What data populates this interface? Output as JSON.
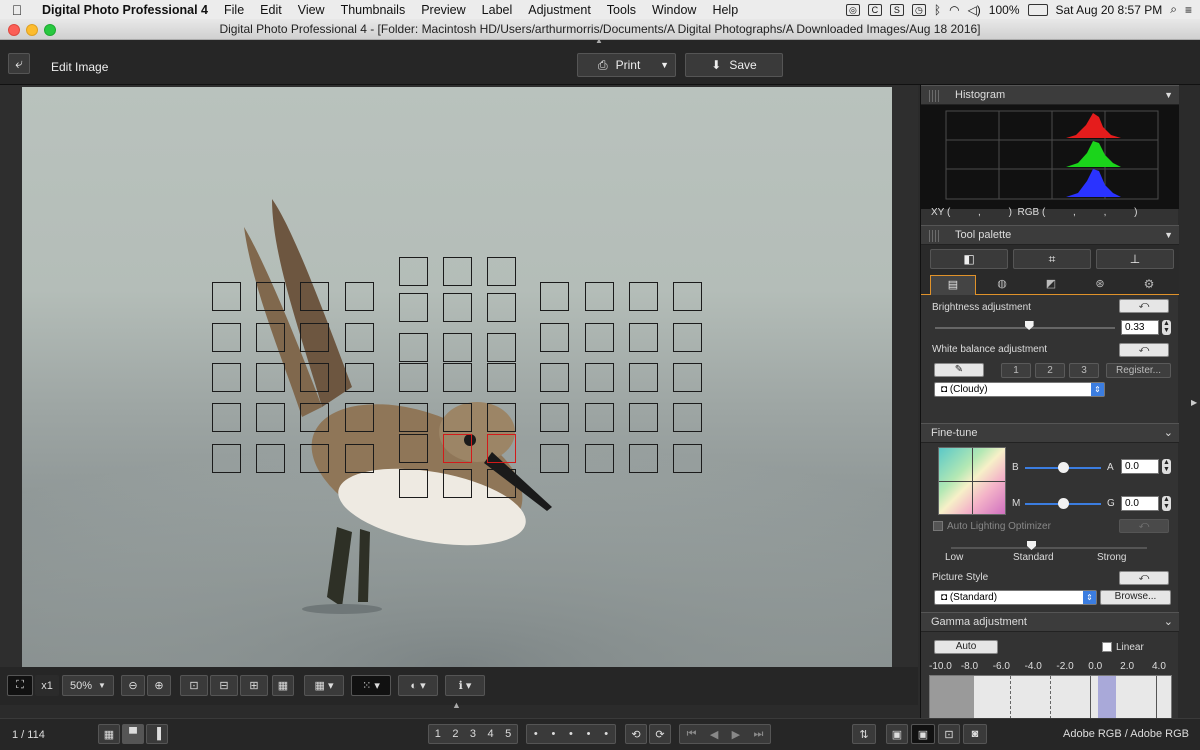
{
  "menubar": {
    "app_name": "Digital Photo Professional 4",
    "items": [
      "File",
      "Edit",
      "View",
      "Thumbnails",
      "Preview",
      "Label",
      "Adjustment",
      "Tools",
      "Window",
      "Help"
    ],
    "battery": "100%",
    "datetime": "Sat Aug 20  8:57 PM"
  },
  "window": {
    "title": "Digital Photo Professional 4 - [Folder: Macintosh HD/Users/arthurmorris/Documents/A Digital Photographs/A Downloaded Images/Aug 18 2016]"
  },
  "toolbar": {
    "mode_label": "Edit Image",
    "print_label": "Print",
    "save_label": "Save"
  },
  "histogram": {
    "title": "Histogram",
    "xy_readout": "XY (          ,          )  RGB (          ,          ,          )"
  },
  "tool_palette": {
    "title": "Tool palette",
    "brightness": {
      "label": "Brightness adjustment",
      "value": "0.33",
      "level": 0.52
    },
    "white_balance": {
      "label": "White balance adjustment",
      "presets": [
        "1",
        "2",
        "3"
      ],
      "register_label": "Register...",
      "selected": "(Cloudy)"
    },
    "fine_tune": {
      "label": "Fine-tune",
      "b_label": "B",
      "a_label": "A",
      "a_value": "0.0",
      "m_label": "M",
      "g_label": "G",
      "g_value": "0.0"
    },
    "alo": {
      "label": "Auto Lighting Optimizer",
      "levels": [
        "Low",
        "Standard",
        "Strong"
      ]
    },
    "picture_style": {
      "label": "Picture Style",
      "selected": "(Standard)",
      "browse_label": "Browse..."
    },
    "gamma": {
      "label": "Gamma adjustment",
      "auto_label": "Auto",
      "linear_label": "Linear",
      "ticks": [
        "-10.0",
        "-8.0",
        "-6.0",
        "-4.0",
        "-2.0",
        "0.0",
        "2.0",
        "4.0"
      ]
    }
  },
  "bottom": {
    "zoom_fit": "x1",
    "zoom_value": "50%",
    "image_counter": "1 / 114",
    "rating_labels": [
      "1",
      "2",
      "3",
      "4",
      "5"
    ],
    "color_space": "Adobe RGB / Adobe RGB"
  }
}
